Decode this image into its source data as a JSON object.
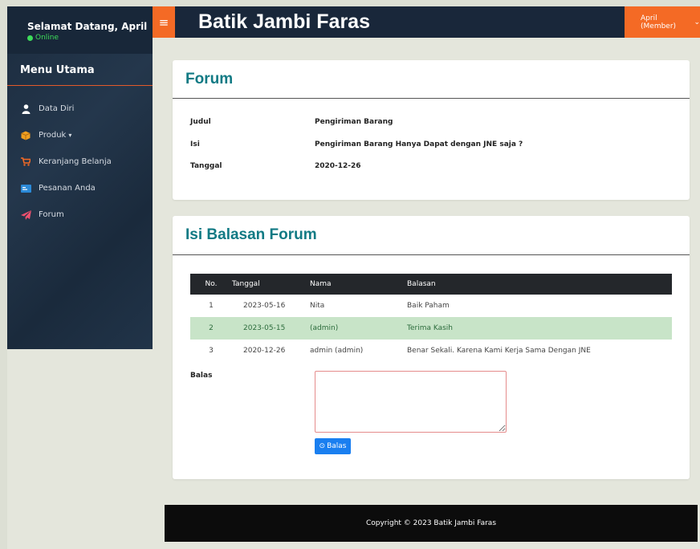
{
  "sidebar": {
    "welcome": "Selamat Datang, April",
    "status": "Online",
    "menu_title": "Menu Utama",
    "items": [
      {
        "label": "Data Diri",
        "icon": "user-icon"
      },
      {
        "label": "Produk",
        "icon": "box-icon",
        "caret": "▾"
      },
      {
        "label": "Keranjang Belanja",
        "icon": "cart-icon"
      },
      {
        "label": "Pesanan Anda",
        "icon": "orders-icon"
      },
      {
        "label": "Forum",
        "icon": "paper-plane-icon"
      }
    ]
  },
  "header": {
    "menu_icon": "≡",
    "brand": "Batik Jambi Faras",
    "user_label": "April (Member)",
    "user_caret": "⌄"
  },
  "forum": {
    "title": "Forum",
    "judul_label": "Judul",
    "judul_value": "Pengiriman Barang",
    "isi_label": "Isi",
    "isi_value": "Pengiriman Barang Hanya Dapat dengan JNE saja ?",
    "tanggal_label": "Tanggal",
    "tanggal_value": "2020-12-26"
  },
  "replies": {
    "title": "Isi Balasan Forum",
    "columns": [
      "No.",
      "Tanggal",
      "Nama",
      "Balasan"
    ],
    "rows": [
      {
        "no": "1",
        "tanggal": "2023-05-16",
        "nama": "Nita",
        "balasan": "Baik Paham"
      },
      {
        "no": "2",
        "tanggal": "2023-05-15",
        "nama": "(admin)",
        "balasan": "Terima Kasih"
      },
      {
        "no": "3",
        "tanggal": "2020-12-26",
        "nama": "admin (admin)",
        "balasan": "Benar Sekali. Karena Kami Kerja Sama Dengan JNE"
      }
    ],
    "reply_label": "Balas",
    "reply_button": "Balas",
    "reply_button_icon": "⊙"
  },
  "footer": {
    "copyright": "Copyright © 2023 Batik Jambi Faras"
  },
  "colors": {
    "accent": "#f46a25",
    "title": "#117a84",
    "sidebar": "#1c2c3f",
    "button": "#1a7ff0"
  }
}
